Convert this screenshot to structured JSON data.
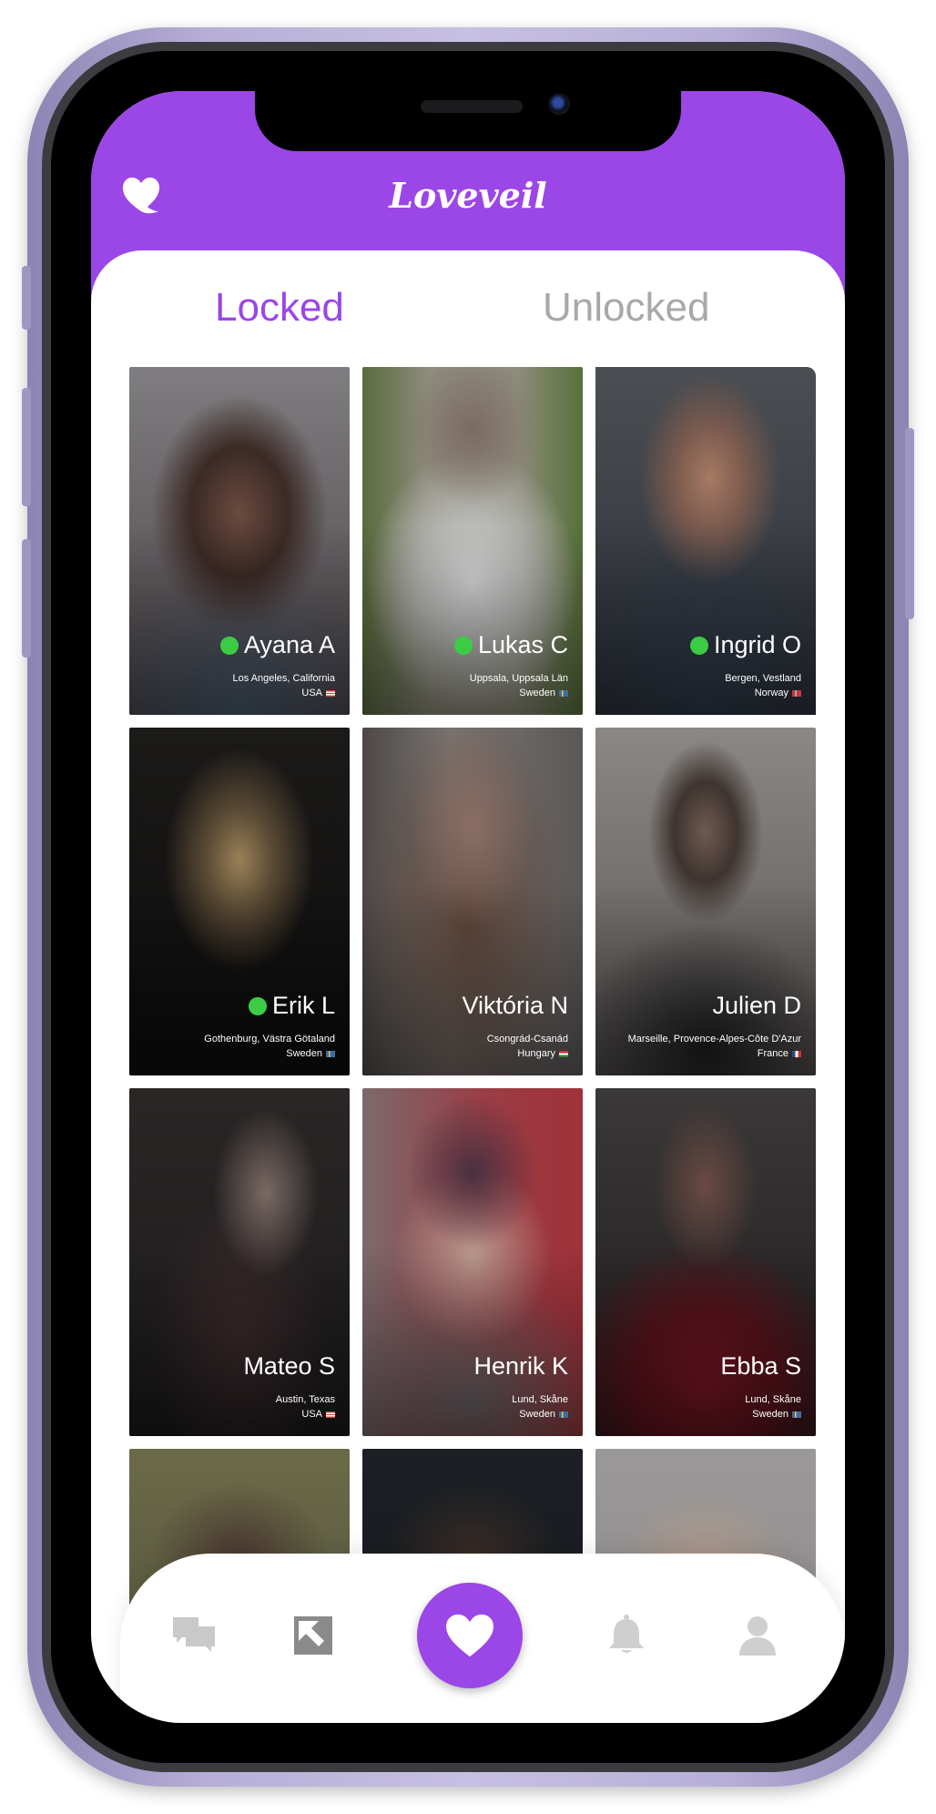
{
  "app": {
    "title": "Loveveil"
  },
  "tabs": {
    "locked": "Locked",
    "unlocked": "Unlocked",
    "active": "Locked"
  },
  "profiles": [
    {
      "name": "Ayana A",
      "online": true,
      "city": "Los Angeles, California",
      "country": "USA",
      "flag": "us"
    },
    {
      "name": "Lukas C",
      "online": true,
      "city": "Uppsala, Uppsala Län",
      "country": "Sweden",
      "flag": "se"
    },
    {
      "name": "Ingrid O",
      "online": true,
      "city": "Bergen, Vestland",
      "country": "Norway",
      "flag": "no"
    },
    {
      "name": "Erik L",
      "online": true,
      "city": "Gothenburg, Västra Götaland",
      "country": "Sweden",
      "flag": "se"
    },
    {
      "name": "Viktória N",
      "online": false,
      "city": "Csongrád-Csanád",
      "country": "Hungary",
      "flag": "hu"
    },
    {
      "name": "Julien D",
      "online": false,
      "city": "Marseille, Provence-Alpes-Côte D'Azur",
      "country": "France",
      "flag": "fr"
    },
    {
      "name": "Mateo S",
      "online": false,
      "city": "Austin, Texas",
      "country": "USA",
      "flag": "us"
    },
    {
      "name": "Henrik K",
      "online": false,
      "city": "Lund, Skåne",
      "country": "Sweden",
      "flag": "se"
    },
    {
      "name": "Ebba S",
      "online": false,
      "city": "Lund, Skåne",
      "country": "Sweden",
      "flag": "se"
    }
  ],
  "nav": {
    "items": [
      "chat-icon",
      "gallery-icon",
      "heart-icon",
      "bell-icon",
      "profile-icon"
    ],
    "active": "heart-icon"
  },
  "colors": {
    "accent": "#9b46e6",
    "online": "#3ccc44",
    "inactive_tab": "#a8a8a8"
  }
}
